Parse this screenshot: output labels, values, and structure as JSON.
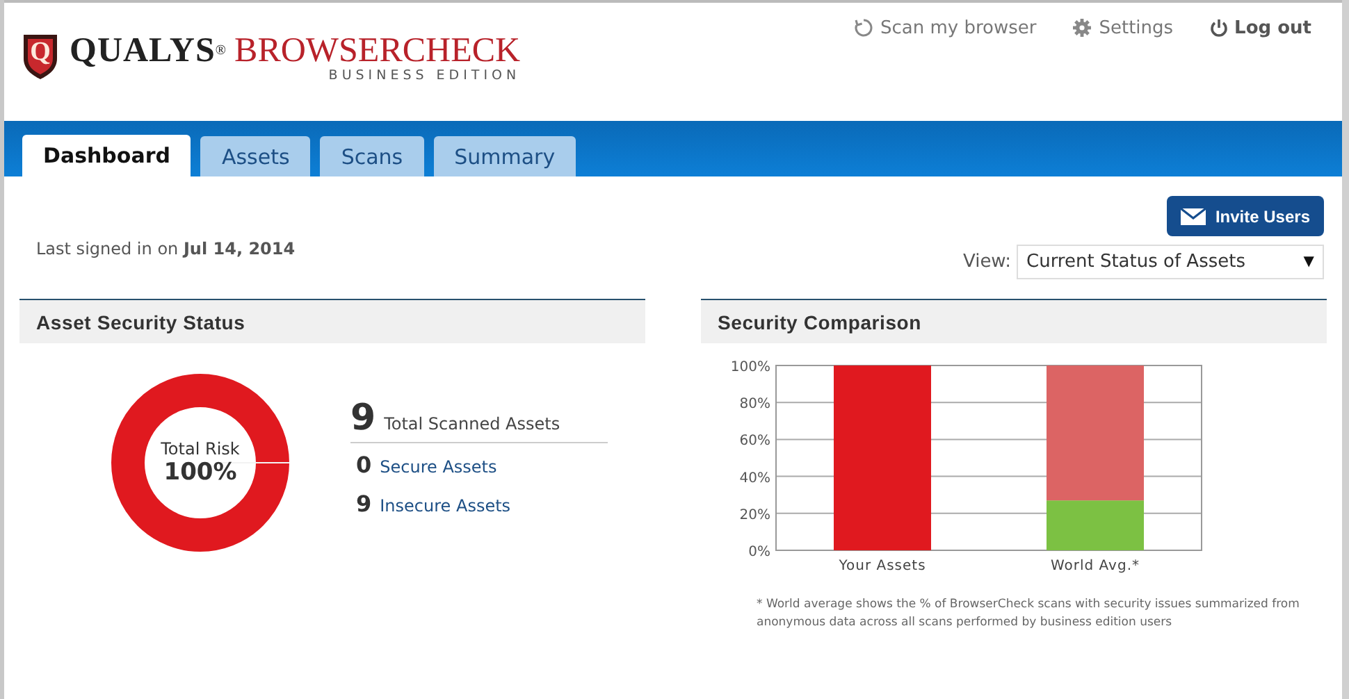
{
  "logo": {
    "brand": "QUALYS",
    "registered": "®",
    "product": "BROWSERCHECK",
    "edition": "BUSINESS EDITION",
    "mark": "Q"
  },
  "top_links": [
    {
      "label": "Scan my browser",
      "kind": "scan"
    },
    {
      "label": "Settings",
      "kind": "settings"
    },
    {
      "label": "Log out",
      "kind": "logout"
    }
  ],
  "tabs": [
    {
      "label": "Dashboard",
      "selected": true
    },
    {
      "label": "Assets",
      "selected": false
    },
    {
      "label": "Scans",
      "selected": false
    },
    {
      "label": "Summary",
      "selected": false
    }
  ],
  "last_signed_in": {
    "prefix": "Last signed in on",
    "date": "Jul 14, 2014"
  },
  "invite_button": "Invite Users",
  "view": {
    "label": "View:",
    "value": "Current Status of Assets",
    "arrow": "▼"
  },
  "asset_status": {
    "title": "Asset Security Status",
    "risk_label": "Total Risk",
    "risk_value": "100%",
    "stats": [
      {
        "count": "9",
        "label": "Total Scanned Assets",
        "kind": "total"
      },
      {
        "count": "0",
        "label": "Secure Assets",
        "kind": "link"
      },
      {
        "count": "9",
        "label": "Insecure Assets",
        "kind": "link"
      }
    ]
  },
  "comparison": {
    "title": "Security Comparison",
    "chart_data": {
      "type": "bar",
      "stacked": true,
      "grid": true,
      "categories": [
        "Your Assets",
        "World Avg.*"
      ],
      "ylim": [
        0,
        100
      ],
      "yticks": [
        {
          "value": 0,
          "label": "0%"
        },
        {
          "value": 20,
          "label": "20%"
        },
        {
          "value": 40,
          "label": "40%"
        },
        {
          "value": 60,
          "label": "60%"
        },
        {
          "value": 80,
          "label": "80%"
        },
        {
          "value": 100,
          "label": "100%"
        }
      ],
      "series": [
        {
          "color": "#7cc143",
          "values": [
            0,
            27
          ]
        },
        {
          "color": "#e0191f",
          "values": [
            100,
            null
          ]
        },
        {
          "color": "#dc6464",
          "values": [
            null,
            73
          ]
        }
      ]
    },
    "footnote": "* World average shows the % of BrowserCheck scans with security issues summarized from anonymous data across all scans performed by business edition users"
  }
}
